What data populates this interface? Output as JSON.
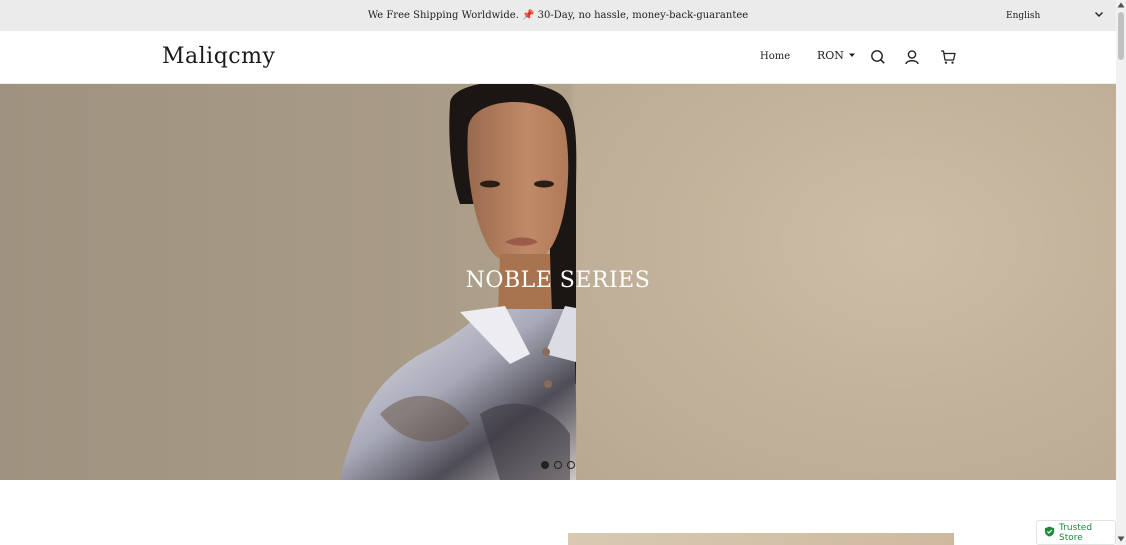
{
  "announcement": {
    "text": "We Free Shipping Worldwide. 📌 30-Day, no hassle, money-back-guarantee",
    "language": "English"
  },
  "header": {
    "logo": "Maliqcmy",
    "nav_home": "Home",
    "currency": "RON",
    "icons": [
      "search-icon",
      "account-icon",
      "cart-icon"
    ]
  },
  "hero": {
    "title": "NOBLE SERIES",
    "slides_total": 3,
    "active_slide": 1
  },
  "trust_badge": {
    "label": "Trusted Store",
    "color": "#1f8a3a"
  }
}
